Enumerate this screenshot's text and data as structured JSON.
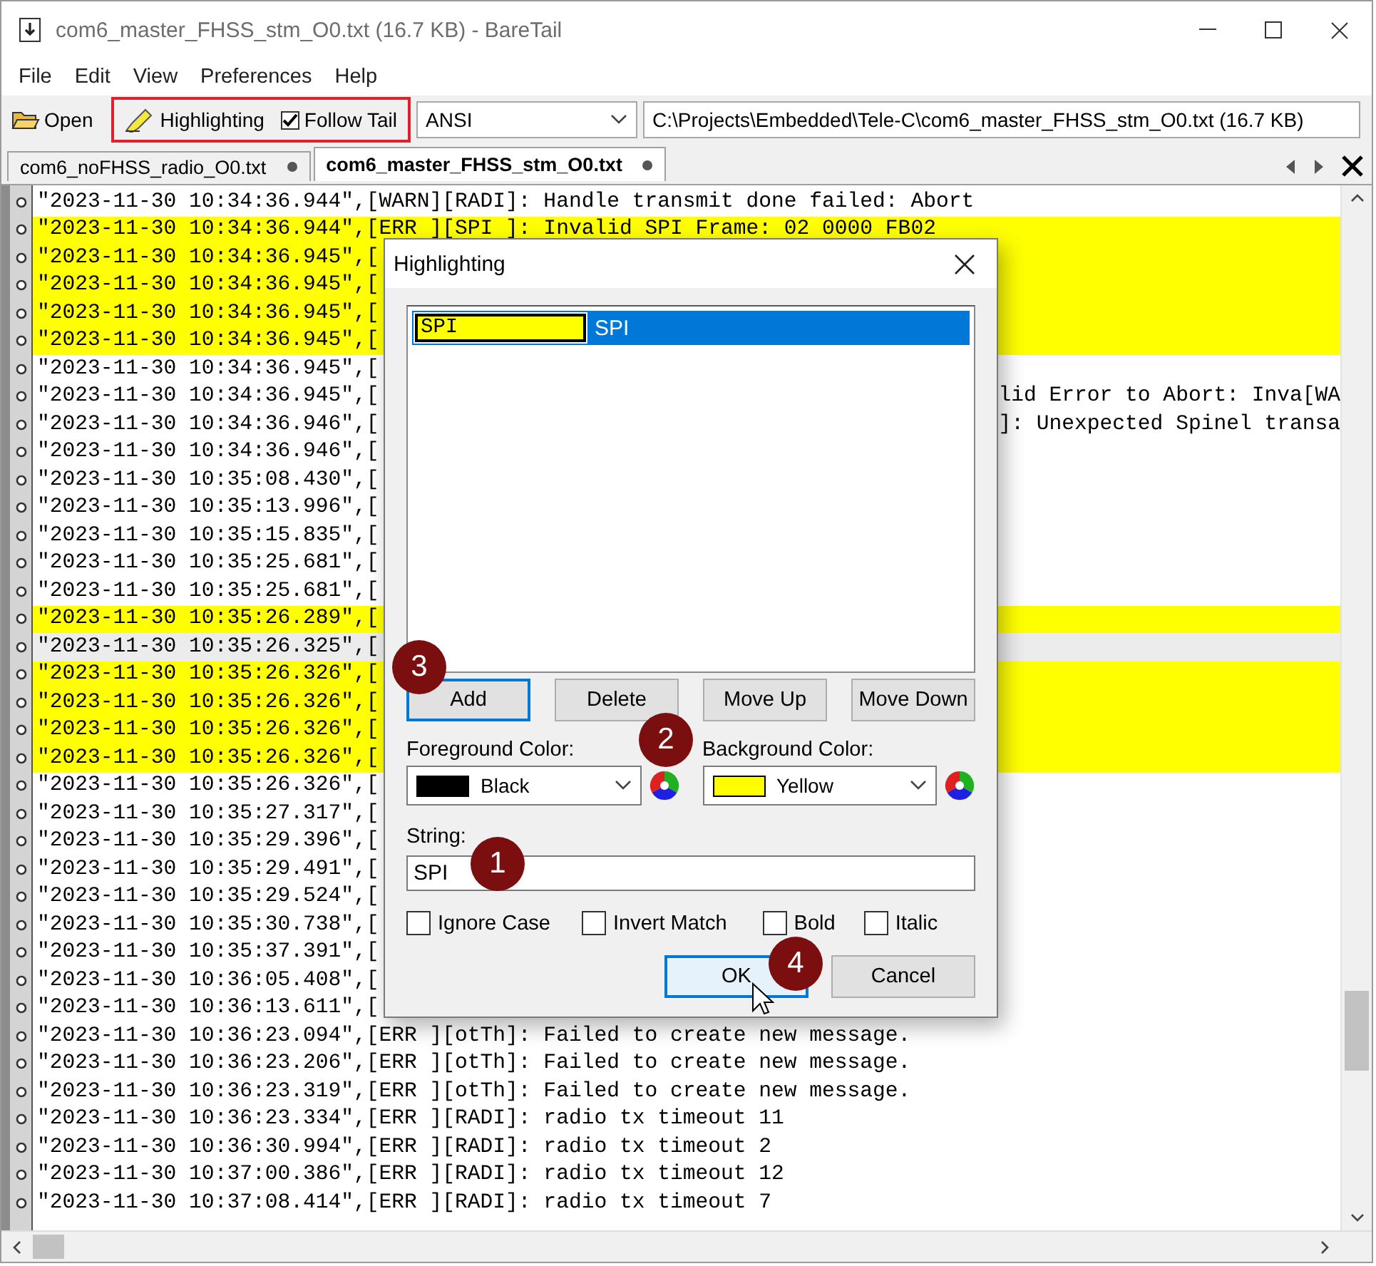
{
  "window": {
    "title": "com6_master_FHSS_stm_O0.txt (16.7 KB) - BareTail"
  },
  "menu": [
    "File",
    "Edit",
    "View",
    "Preferences",
    "Help"
  ],
  "toolbar": {
    "open": "Open",
    "highlighting": "Highlighting",
    "follow_tail": {
      "label": "Follow Tail",
      "checked": true
    },
    "encoding": "ANSI",
    "path": "C:\\Projects\\Embedded\\Tele-C\\com6_master_FHSS_stm_O0.txt (16.7 KB)"
  },
  "tabs": [
    {
      "label": "com6_noFHSS_radio_O0.txt",
      "selected": false
    },
    {
      "label": "com6_master_FHSS_stm_O0.txt",
      "selected": true
    }
  ],
  "log": [
    {
      "text": "\"2023-11-30 10:34:36.944\",[WARN][RADI]: Handle transmit done failed: Abort",
      "highlighted": false,
      "selected": false
    },
    {
      "text": "\"2023-11-30 10:34:36.944\",[ERR ][SPI ]: Invalid SPI Frame: 02 0000 FB02",
      "highlighted": true,
      "selected": false
    },
    {
      "text": "\"2023-11-30 10:34:36.945\",[",
      "highlighted": true,
      "selected": false
    },
    {
      "text": "\"2023-11-30 10:34:36.945\",[",
      "highlighted": true,
      "selected": false
    },
    {
      "text": "\"2023-11-30 10:34:36.945\",[",
      "highlighted": true,
      "selected": false
    },
    {
      "text": "\"2023-11-30 10:34:36.945\",[",
      "highlighted": true,
      "selected": false
    },
    {
      "text": "\"2023-11-30 10:34:36.945\",[",
      "highlighted": false,
      "selected": false
    },
    {
      "text": "\"2023-11-30 10:34:36.945\",[",
      "tail": "lid Error to Abort: Inva[WA",
      "highlighted": false,
      "selected": false
    },
    {
      "text": "\"2023-11-30 10:34:36.946\",[",
      "tail": "]: Unexpected Spinel transa",
      "highlighted": false,
      "selected": false
    },
    {
      "text": "\"2023-11-30 10:34:36.946\",[",
      "highlighted": false,
      "selected": false
    },
    {
      "text": "\"2023-11-30 10:35:08.430\",[",
      "highlighted": false,
      "selected": false
    },
    {
      "text": "\"2023-11-30 10:35:13.996\",[",
      "highlighted": false,
      "selected": false
    },
    {
      "text": "\"2023-11-30 10:35:15.835\",[",
      "highlighted": false,
      "selected": false
    },
    {
      "text": "\"2023-11-30 10:35:25.681\",[",
      "highlighted": false,
      "selected": false
    },
    {
      "text": "\"2023-11-30 10:35:25.681\",[",
      "highlighted": false,
      "selected": false
    },
    {
      "text": "\"2023-11-30 10:35:26.289\",[",
      "highlighted": true,
      "selected": false
    },
    {
      "text": "\"2023-11-30 10:35:26.325\",[",
      "highlighted": false,
      "selected": true
    },
    {
      "text": "\"2023-11-30 10:35:26.326\",[",
      "highlighted": true,
      "selected": false
    },
    {
      "text": "\"2023-11-30 10:35:26.326\",[",
      "highlighted": true,
      "selected": false
    },
    {
      "text": "\"2023-11-30 10:35:26.326\",[",
      "highlighted": true,
      "selected": false
    },
    {
      "text": "\"2023-11-30 10:35:26.326\",[",
      "highlighted": true,
      "selected": false
    },
    {
      "text": "\"2023-11-30 10:35:26.326\",[",
      "highlighted": false,
      "selected": false
    },
    {
      "text": "\"2023-11-30 10:35:27.317\",[",
      "highlighted": false,
      "selected": false
    },
    {
      "text": "\"2023-11-30 10:35:29.396\",[",
      "highlighted": false,
      "selected": false
    },
    {
      "text": "\"2023-11-30 10:35:29.491\",[",
      "highlighted": false,
      "selected": false
    },
    {
      "text": "\"2023-11-30 10:35:29.524\",[",
      "highlighted": false,
      "selected": false
    },
    {
      "text": "\"2023-11-30 10:35:30.738\",[",
      "highlighted": false,
      "selected": false
    },
    {
      "text": "\"2023-11-30 10:35:37.391\",[",
      "highlighted": false,
      "selected": false
    },
    {
      "text": "\"2023-11-30 10:36:05.408\",[",
      "highlighted": false,
      "selected": false
    },
    {
      "text": "\"2023-11-30 10:36:13.611\",[",
      "highlighted": false,
      "selected": false
    },
    {
      "text": "\"2023-11-30 10:36:23.094\",[ERR ][otTh]: Failed to create new message.",
      "highlighted": false,
      "selected": false
    },
    {
      "text": "\"2023-11-30 10:36:23.206\",[ERR ][otTh]: Failed to create new message.",
      "highlighted": false,
      "selected": false
    },
    {
      "text": "\"2023-11-30 10:36:23.319\",[ERR ][otTh]: Failed to create new message.",
      "highlighted": false,
      "selected": false
    },
    {
      "text": "\"2023-11-30 10:36:23.334\",[ERR ][RADI]: radio tx timeout 11",
      "highlighted": false,
      "selected": false
    },
    {
      "text": "\"2023-11-30 10:36:30.994\",[ERR ][RADI]: radio tx timeout 2",
      "highlighted": false,
      "selected": false
    },
    {
      "text": "\"2023-11-30 10:37:00.386\",[ERR ][RADI]: radio tx timeout 12",
      "highlighted": false,
      "selected": false
    },
    {
      "text": "\"2023-11-30 10:37:08.414\",[ERR ][RADI]: radio tx timeout 7",
      "highlighted": false,
      "selected": false
    }
  ],
  "dialog": {
    "title": "Highlighting",
    "rules": [
      {
        "string": "SPI",
        "label": "SPI",
        "color": "#ffff00",
        "selected": true
      }
    ],
    "buttons": [
      {
        "label": "Add",
        "focused": true
      },
      {
        "label": "Delete",
        "focused": false
      },
      {
        "label": "Move Up",
        "focused": false
      },
      {
        "label": "Move Down",
        "focused": false
      }
    ],
    "foreground": {
      "label": "Foreground Color:",
      "value": "Black",
      "color": "#000000"
    },
    "background": {
      "label": "Background Color:",
      "value": "Yellow",
      "color": "#ffff00"
    },
    "string": {
      "label": "String:",
      "value": "SPI"
    },
    "options": [
      {
        "label": "Ignore Case",
        "checked": false
      },
      {
        "label": "Invert Match",
        "checked": false
      },
      {
        "label": "Bold",
        "checked": false
      },
      {
        "label": "Italic",
        "checked": false
      }
    ],
    "actions": [
      {
        "label": "OK",
        "focused": true
      },
      {
        "label": "Cancel",
        "focused": false
      }
    ]
  },
  "callouts": [
    "1",
    "2",
    "3",
    "4"
  ]
}
